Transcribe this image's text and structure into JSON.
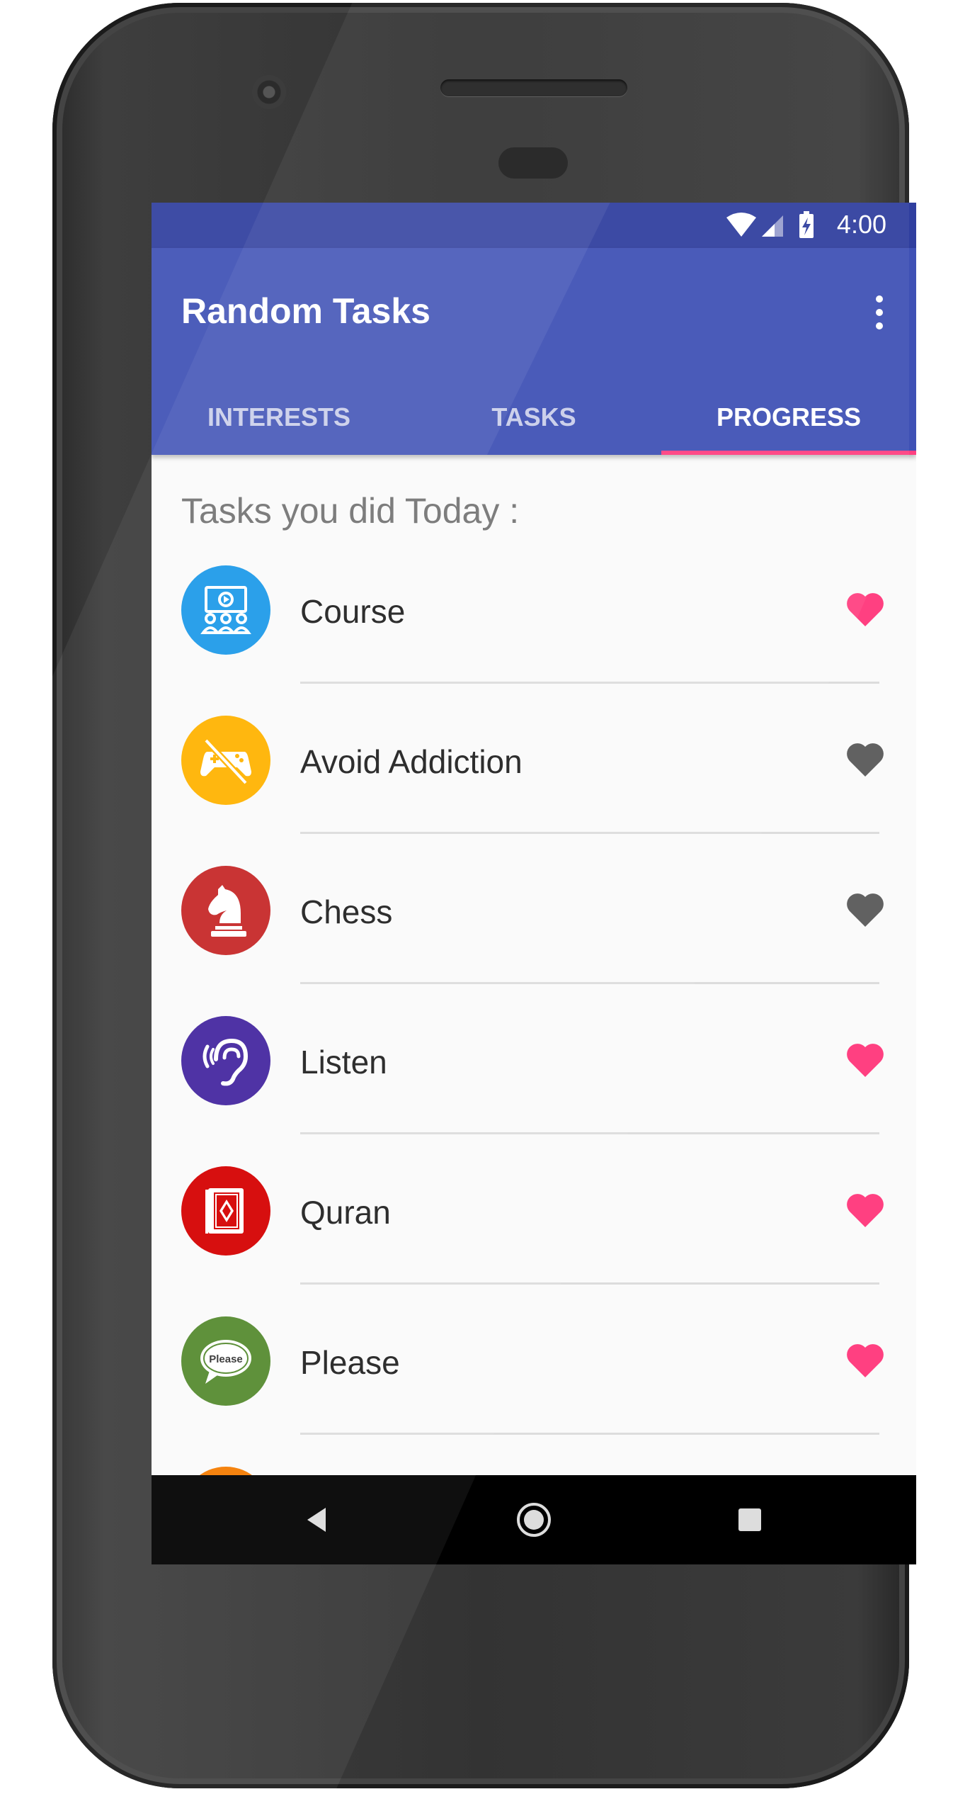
{
  "status": {
    "time": "4:00"
  },
  "app": {
    "title": "Random Tasks"
  },
  "tabs": [
    {
      "label": "INTERESTS",
      "active": false
    },
    {
      "label": "TASKS",
      "active": false
    },
    {
      "label": "PROGRESS",
      "active": true
    }
  ],
  "section_title": "Tasks you did Today :",
  "tasks": [
    {
      "label": "Course",
      "icon": "course-video-icon",
      "color": "#1e9be9",
      "liked": true
    },
    {
      "label": "Avoid Addiction",
      "icon": "no-gaming-icon",
      "color": "#ffb300",
      "liked": false
    },
    {
      "label": "Chess",
      "icon": "chess-knight-icon",
      "color": "#c62828",
      "liked": false
    },
    {
      "label": "Listen",
      "icon": "ear-listen-icon",
      "color": "#4527a0",
      "liked": true
    },
    {
      "label": "Quran",
      "icon": "quran-book-icon",
      "color": "#d50000",
      "liked": true
    },
    {
      "label": "Please",
      "icon": "please-speech-icon",
      "icon_text": "Please",
      "color": "#558b2f",
      "liked": true
    }
  ],
  "colors": {
    "primary": "#3f51b5",
    "primary_dark": "#303f9f",
    "accent": "#ff4081",
    "heart_liked": "#ff4081",
    "heart_unliked": "#616161"
  }
}
